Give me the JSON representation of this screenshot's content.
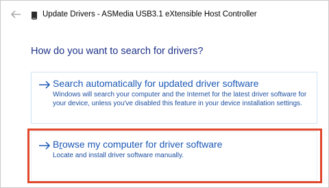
{
  "window": {
    "title": "Update Drivers - ASMedia USB3.1 eXtensible Host Controller"
  },
  "heading": "How do you want to search for drivers?",
  "options": [
    {
      "title": "Search automatically for updated driver software",
      "description": "Windows will search your computer and the Internet for the latest driver software for your device, unless you've disabled this feature in your device installation settings."
    },
    {
      "title_underlined_letter": "r",
      "title_prefix": "B",
      "title_rest": "owse my computer for driver software",
      "title": "Browse my computer for driver software",
      "description": "Locate and install driver software manually."
    }
  ],
  "icons": {
    "back": "back-arrow-icon",
    "device": "device-icon",
    "option_arrow": "arrow-right-icon"
  },
  "colors": {
    "link_blue": "#1a57b5",
    "heading_blue": "#1e3287",
    "highlight_red": "#e0472b"
  }
}
